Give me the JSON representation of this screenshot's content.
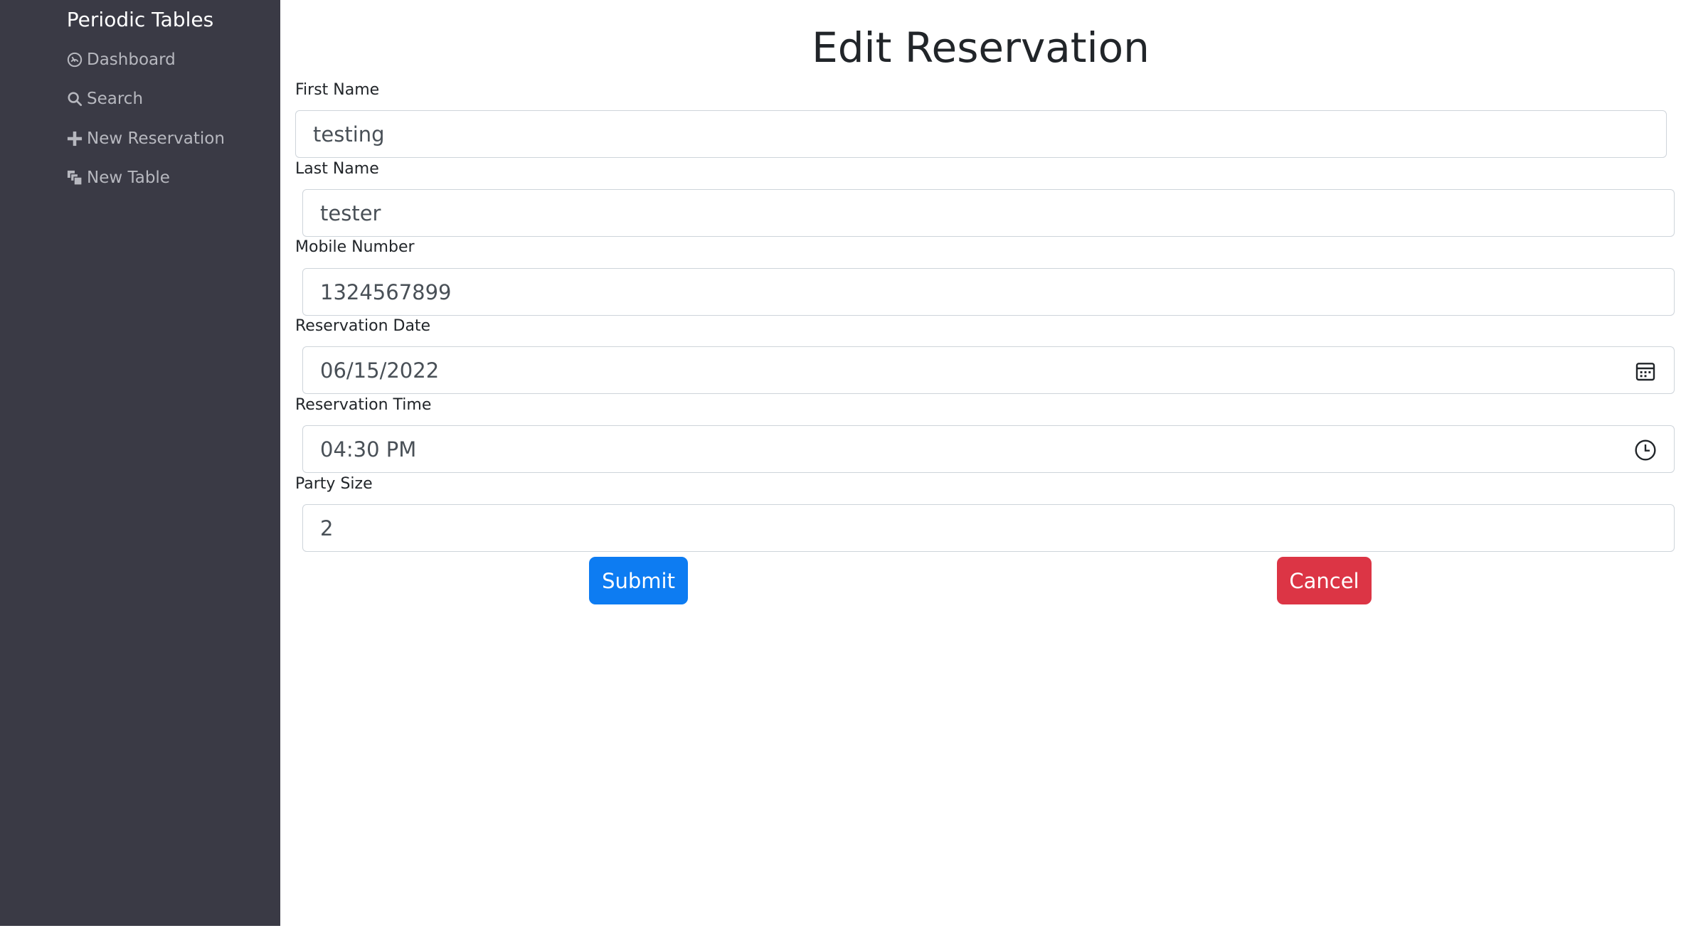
{
  "sidebar": {
    "brand": "Periodic Tables",
    "items": [
      {
        "label": "Dashboard",
        "icon": "dashboard-gauge-icon"
      },
      {
        "label": "Search",
        "icon": "search-icon"
      },
      {
        "label": "New Reservation",
        "icon": "plus-icon"
      },
      {
        "label": "New Table",
        "icon": "layers-icon"
      }
    ]
  },
  "main": {
    "title": "Edit Reservation"
  },
  "form": {
    "first_name": {
      "label": "First Name",
      "value": "testing"
    },
    "last_name": {
      "label": "Last Name",
      "value": "tester"
    },
    "mobile_number": {
      "label": "Mobile Number",
      "value": "1324567899"
    },
    "reservation_date": {
      "label": "Reservation Date",
      "value": "06/15/2022",
      "icon": "calendar-icon"
    },
    "reservation_time": {
      "label": "Reservation Time",
      "value": "04:30 PM",
      "icon": "clock-icon"
    },
    "party_size": {
      "label": "Party Size",
      "value": "2"
    }
  },
  "actions": {
    "submit_label": "Submit",
    "cancel_label": "Cancel"
  },
  "colors": {
    "sidebar_bg": "#3a3a45",
    "submit": "#0d7cf2",
    "cancel": "#dc3545"
  }
}
